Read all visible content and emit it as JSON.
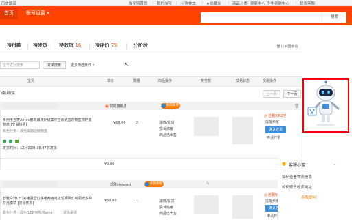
{
  "topbar": {
    "left": "历史翻译",
    "items": [
      "淘宝网首页",
      "我的淘宝",
      "购物车",
      "收藏夹",
      "商品分类",
      "卖家中心",
      "千牛卖家中心",
      "联系客服"
    ],
    "favorites_count": "0"
  },
  "nav": {
    "home": "首页",
    "account_settings": "账号设置",
    "search_button": "搜索"
  },
  "tabs": [
    {
      "label": "待付款",
      "count": ""
    },
    {
      "label": "待发货",
      "count": ""
    },
    {
      "label": "待收货",
      "count": "16"
    },
    {
      "label": "待评价",
      "count": "75"
    },
    {
      "label": "分阶段",
      "count": ""
    }
  ],
  "recycle": "订单回收站",
  "filter": {
    "placeholder": "宝号进行搜索",
    "search_btn": "订单搜索",
    "more": "更多筛选条件"
  },
  "table_headers": [
    "宝贝",
    "单价",
    "数量",
    "商品操作",
    "实付款",
    "交易状态",
    "交易操作"
  ],
  "pager": {
    "batch": "确认收货",
    "prev": "上一页",
    "next": "下一页"
  },
  "orders": [
    {
      "shop": "赞赞旗舰店",
      "badge": "和我联系",
      "title": "专用于五菱Air ev鹤驾爆改升级案中控收纳盒杂物盒次杯置物盒 [交易快照]",
      "spec": "颜色分类：晨光黑翻边储物盒",
      "time": "发货时间：12月01日 15:47前发货",
      "price": "¥68.00",
      "qty": "2",
      "ops": [
        "退款/退货",
        "投诉商家",
        "商品已出售"
      ],
      "status_time": "还剩9天2时",
      "remind": "提醒卖家",
      "confirm": "确认收货",
      "apply": "申请开票",
      "subtotal": "¥0.00"
    },
    {
      "shop": "舒雅sleevest",
      "badge": "和我联系",
      "title": "舒雅户外LED充电露营灯手电两用可挂式照明灯可调光多种灯光模式 [交易快照]",
      "spec": "颜色分类：白色/LED充电/Bamp",
      "extra": "退货承诺",
      "price": "¥59.00",
      "qty": "1",
      "ops": [
        "退款/退货",
        "投诉商家",
        "商品已出售"
      ],
      "status_time": "还剩9天9时",
      "remind": "提醒卖家",
      "confirm": "确认收货",
      "apply": "申请开票"
    }
  ],
  "mini": {
    "title": "客服小蜜",
    "q1": "如何查看物流信息",
    "q2": "如何修改收货地址",
    "more": "点我提问"
  },
  "robot_label": "Jiliangfrt"
}
